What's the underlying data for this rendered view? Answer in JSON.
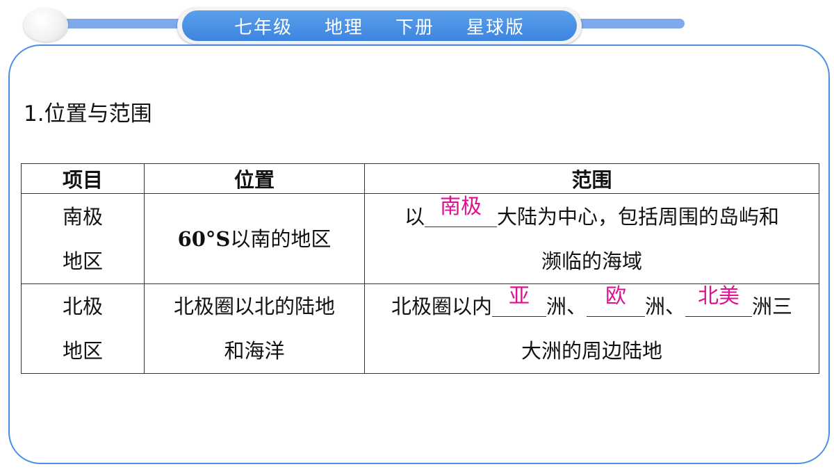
{
  "header": {
    "items": [
      "七年级",
      "地理",
      "下册",
      "星球版"
    ]
  },
  "section": {
    "title": "1.位置与范围"
  },
  "table": {
    "headers": [
      "项目",
      "位置",
      "范围"
    ],
    "rows": [
      {
        "item_line1": "南极",
        "item_line2": "地区",
        "position_bold": "60°S",
        "position_rest": "以南的地区",
        "range_prefix": "以",
        "answer1": "南极",
        "range_mid": "大陆为中心，包括周围的岛屿和",
        "range_line2": "濒临的海域"
      },
      {
        "item_line1": "北极",
        "item_line2": "地区",
        "position_line1": "北极圈以北的陆地",
        "position_line2": "和海洋",
        "range_prefix": "北极圈以内",
        "answer1": "亚",
        "sep1": "洲、",
        "answer2": "欧",
        "sep2": "洲、",
        "answer3": "北美",
        "range_suffix": "洲三",
        "range_line2": "大洲的周边陆地"
      }
    ]
  },
  "colors": {
    "accent": "#4a8fe6",
    "answer": "#e0118f",
    "header_bar": "#7fa9ea"
  }
}
